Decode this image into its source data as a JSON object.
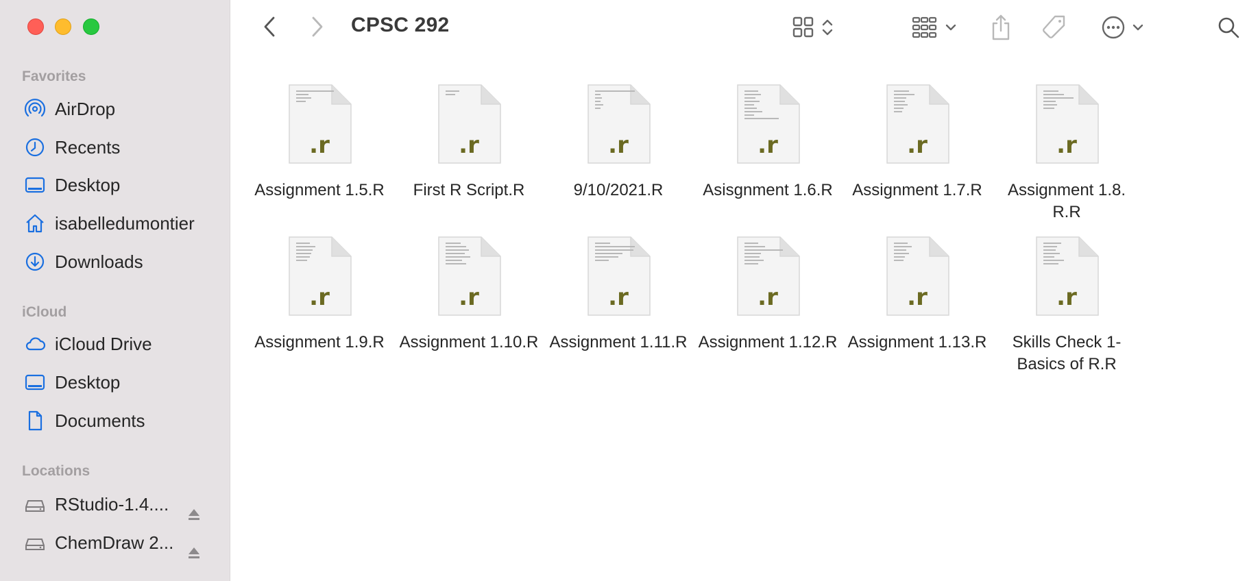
{
  "window": {
    "title": "CPSC 292"
  },
  "sidebar": {
    "favorites_header": "Favorites",
    "favorites": [
      {
        "label": "AirDrop",
        "icon": "airdrop-icon"
      },
      {
        "label": "Recents",
        "icon": "clock-icon"
      },
      {
        "label": "Desktop",
        "icon": "desktop-icon"
      },
      {
        "label": "isabelledumontier",
        "icon": "home-icon"
      },
      {
        "label": "Downloads",
        "icon": "download-icon"
      }
    ],
    "icloud_header": "iCloud",
    "icloud": [
      {
        "label": "iCloud Drive",
        "icon": "cloud-icon"
      },
      {
        "label": "Desktop",
        "icon": "desktop-icon"
      },
      {
        "label": "Documents",
        "icon": "document-icon"
      }
    ],
    "locations_header": "Locations",
    "locations": [
      {
        "label": "RStudio-1.4....",
        "icon": "drive-icon"
      },
      {
        "label": "ChemDraw 2...",
        "icon": "drive-icon"
      }
    ]
  },
  "files": [
    {
      "name": "Assignment 1.5.R",
      "ext": ".r"
    },
    {
      "name": "First R Script.R",
      "ext": ".r"
    },
    {
      "name": "9/10/2021.R",
      "ext": ".r"
    },
    {
      "name": "Asisgnment 1.6.R",
      "ext": ".r"
    },
    {
      "name": "Assignment 1.7.R",
      "ext": ".r"
    },
    {
      "name": "Assignment 1.8.",
      "name2": "R.R",
      "ext": ".r"
    },
    {
      "name": "Assignment 1.9.R",
      "ext": ".r"
    },
    {
      "name": "Assignment 1.10.R",
      "ext": ".r"
    },
    {
      "name": "Assignment 1.11.R",
      "ext": ".r"
    },
    {
      "name": "Assignment 1.12.R",
      "ext": ".r"
    },
    {
      "name": "Assignment 1.13.R",
      "ext": ".r"
    },
    {
      "name": "Skills Check 1-",
      "name2": "Basics of R.R",
      "ext": ".r"
    }
  ],
  "colors": {
    "sidebar_bg": "#e6e2e4",
    "accent": "#1a6fe0",
    "ext_text": "#6b6a22"
  }
}
